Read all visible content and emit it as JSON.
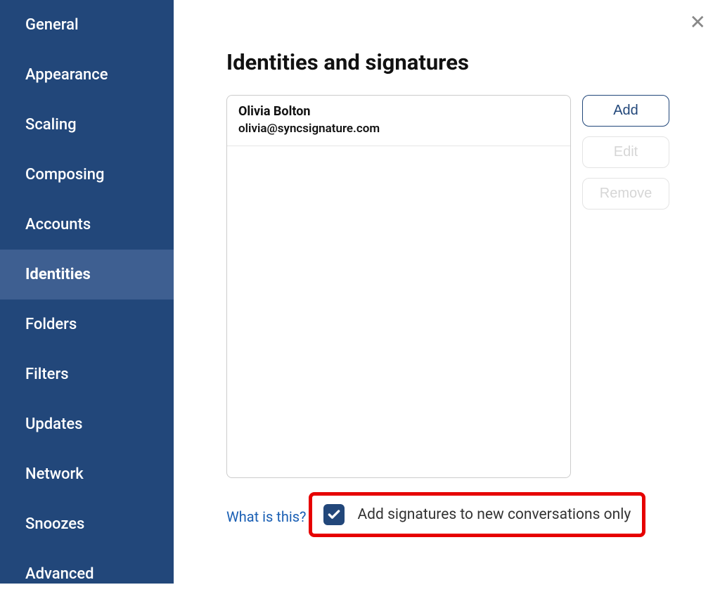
{
  "sidebar": {
    "items": [
      {
        "label": "General",
        "active": false
      },
      {
        "label": "Appearance",
        "active": false
      },
      {
        "label": "Scaling",
        "active": false
      },
      {
        "label": "Composing",
        "active": false
      },
      {
        "label": "Accounts",
        "active": false
      },
      {
        "label": "Identities",
        "active": true
      },
      {
        "label": "Folders",
        "active": false
      },
      {
        "label": "Filters",
        "active": false
      },
      {
        "label": "Updates",
        "active": false
      },
      {
        "label": "Network",
        "active": false
      },
      {
        "label": "Snoozes",
        "active": false
      },
      {
        "label": "Advanced",
        "active": false
      }
    ]
  },
  "main": {
    "title": "Identities and signatures",
    "identities": [
      {
        "name": "Olivia Bolton",
        "email": "olivia@syncsignature.com"
      }
    ],
    "buttons": {
      "add": "Add",
      "edit": "Edit",
      "remove": "Remove"
    },
    "help_link": "What is this?",
    "checkbox_label": "Add signatures to new conversations only",
    "checkbox_checked": true
  }
}
